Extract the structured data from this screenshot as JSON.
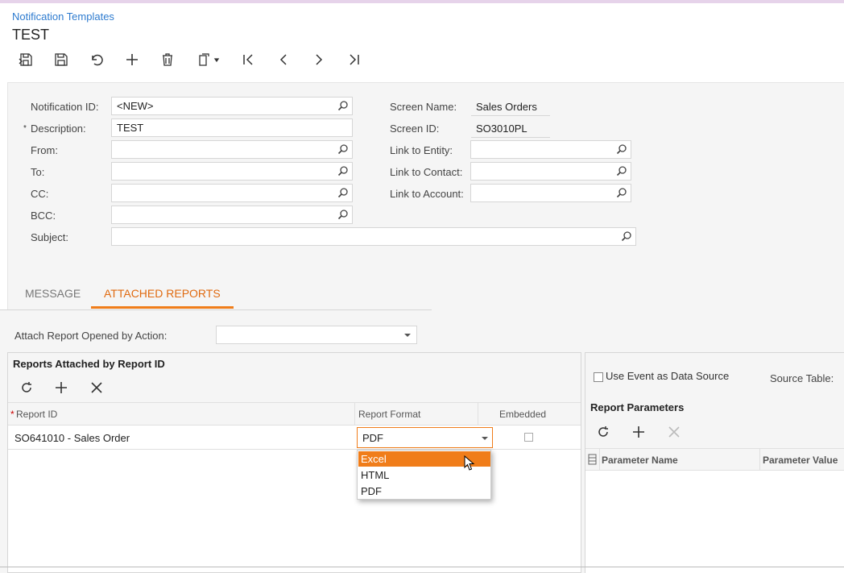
{
  "breadcrumb": "Notification Templates",
  "title": "TEST",
  "toolbar": {
    "icons": [
      "save-close-icon",
      "save-icon",
      "undo-icon",
      "add-icon",
      "delete-icon",
      "copy-paste-icon",
      "first-icon",
      "previous-icon",
      "next-icon",
      "last-icon"
    ]
  },
  "form": {
    "notification_id_label": "Notification ID:",
    "notification_id_value": "<NEW>",
    "description_label": "Description:",
    "description_value": "TEST",
    "required_mark": "*",
    "from_label": "From:",
    "to_label": "To:",
    "cc_label": "CC:",
    "bcc_label": "BCC:",
    "subject_label": "Subject:",
    "screen_name_label": "Screen Name:",
    "screen_name_value": "Sales Orders",
    "screen_id_label": "Screen ID:",
    "screen_id_value": "SO3010PL",
    "link_entity_label": "Link to Entity:",
    "link_contact_label": "Link to Contact:",
    "link_account_label": "Link to Account:"
  },
  "tabs": [
    {
      "label": "MESSAGE",
      "active": false
    },
    {
      "label": "ATTACHED REPORTS",
      "active": true
    }
  ],
  "attach": {
    "label": "Attach Report Opened by Action:",
    "value": ""
  },
  "left_panel": {
    "title": "Reports Attached by Report ID",
    "columns": {
      "report_id": "Report ID",
      "report_format": "Report Format",
      "embedded": "Embedded"
    },
    "rows": [
      {
        "report_id": "SO641010 - Sales Order",
        "format": "PDF",
        "embedded": false
      }
    ],
    "format_options": [
      "Excel",
      "HTML",
      "PDF"
    ],
    "highlighted_option": "Excel"
  },
  "right_panel": {
    "use_event_label": "Use Event as Data Source",
    "source_table_label": "Source Table:",
    "params_title": "Report Parameters",
    "columns": {
      "name": "Parameter Name",
      "value": "Parameter Value"
    }
  },
  "colors": {
    "accent": "#f07d1a",
    "link": "#2e7bcf"
  }
}
